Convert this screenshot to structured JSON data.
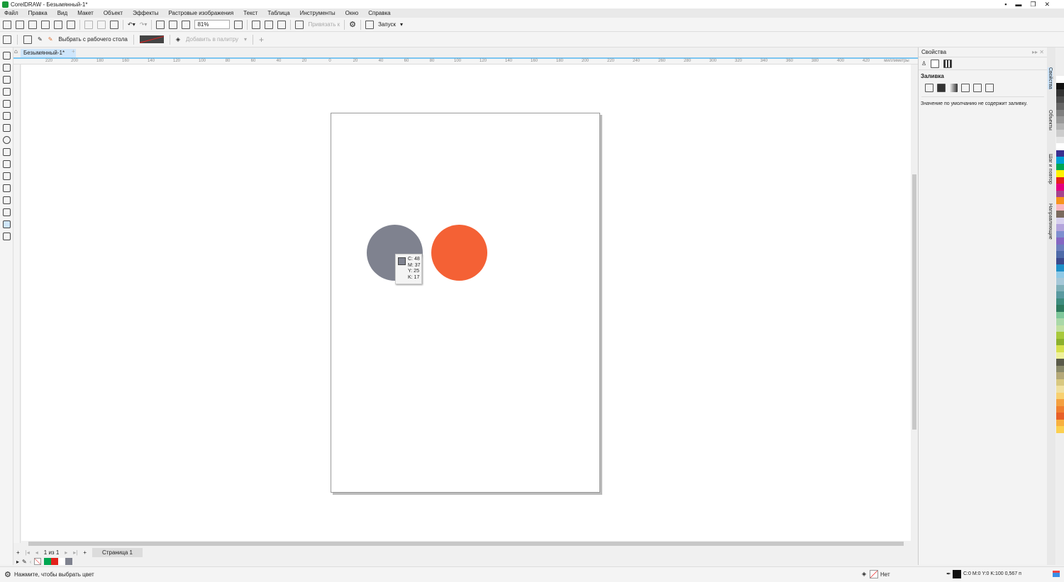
{
  "title": "CorelDRAW - Безымянный-1*",
  "menu": [
    "Файл",
    "Правка",
    "Вид",
    "Макет",
    "Объект",
    "Эффекты",
    "Растровые изображения",
    "Текст",
    "Таблица",
    "Инструменты",
    "Окно",
    "Справка"
  ],
  "toolbar": {
    "zoom": "81%",
    "snap": "Привязать к",
    "launch": "Запуск"
  },
  "propbar": {
    "pick": "Выбрать с рабочего стола",
    "add_palette": "Добавить в палитру"
  },
  "doc_tab": "Безымянный-1*",
  "ruler": {
    "labels": [
      "220",
      "200",
      "180",
      "160",
      "140",
      "120",
      "100",
      "80",
      "60",
      "40",
      "20",
      "0",
      "20",
      "40",
      "60",
      "80",
      "100",
      "120",
      "140",
      "160",
      "180",
      "200",
      "220",
      "240",
      "260",
      "280",
      "300",
      "320",
      "340",
      "360",
      "380",
      "400",
      "420"
    ],
    "unit": "миллиметры"
  },
  "shapes": [
    {
      "name": "gray-circle",
      "color": "#7f828f"
    },
    {
      "name": "orange-circle",
      "color": "#f46135"
    }
  ],
  "tooltip": {
    "c": "C: 48",
    "m": "M: 37",
    "y": "Y: 25",
    "k": "K: 17"
  },
  "pagenav": {
    "count": "1 из 1",
    "page": "Страница 1"
  },
  "doc_palette": [
    "#00a651",
    "#e3221c",
    "#ffffff",
    "#7f828f"
  ],
  "status": {
    "hint": "Нажмите, чтобы выбрать цвет",
    "fill": "Нет",
    "outline": "C:0 M:0 Y:0 K:100  0,567 п"
  },
  "panel": {
    "title": "Свойства",
    "section": "Заливка",
    "message": "Значение по умолчанию не содержит заливку."
  },
  "side_tabs": [
    "Свойства",
    "Объекты",
    "Шаг и повтор",
    "Направляющие"
  ],
  "palette": [
    "#ffffff",
    "#111111",
    "#333333",
    "#4d4d4d",
    "#666666",
    "#808080",
    "#999999",
    "#b3b3b3",
    "#cccccc",
    "#e6e6e6",
    "#ffffff",
    "#3b2f8f",
    "#00a0d6",
    "#00a651",
    "#fff200",
    "#e3221c",
    "#e5007e",
    "#a4448f",
    "#f7941d",
    "#f9b7c0",
    "#7a6a5e",
    "#d7d0ee",
    "#b3a4dc",
    "#7e8fd0",
    "#8567c2",
    "#6c7fbd",
    "#4e6aa8",
    "#3c4a8c",
    "#1e90c8",
    "#8fc9e6",
    "#a6c8d8",
    "#7fb0b8",
    "#5a9aa0",
    "#3e8c7e",
    "#2e7a5e",
    "#7fc79a",
    "#a9d8a8",
    "#c2e0a2",
    "#a8c93c",
    "#8cb02e",
    "#d6e04c",
    "#eef09a",
    "#5a5a4a",
    "#8a8a6a",
    "#b4a878",
    "#d8c880",
    "#f0e0a0",
    "#f8d070",
    "#f4a040",
    "#f08030",
    "#e86028",
    "#f8b040",
    "#fcd050"
  ]
}
